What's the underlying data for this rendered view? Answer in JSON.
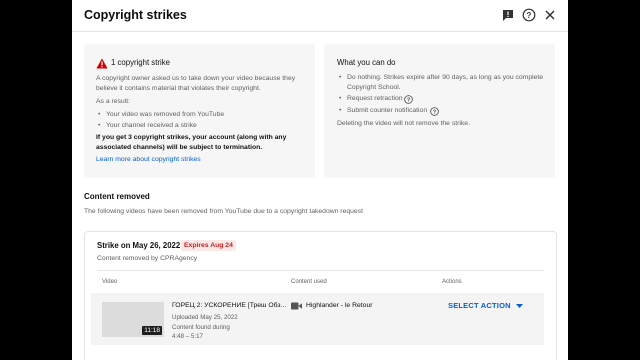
{
  "dialog": {
    "title": "Copyright strikes",
    "icons": [
      "feedback-icon",
      "help-icon",
      "close-icon"
    ]
  },
  "summary": {
    "heading": "1 copyright strike",
    "desc_line1": "A copyright owner asked us to take down your video because they",
    "desc_line2": "believe it contains material that violates their copyright.",
    "result_label": "As a result:",
    "results": [
      "Your video was removed from YouTube",
      "Your channel received a strike"
    ],
    "warning_line1": "If you get 3 copyright strikes, your account (along with any",
    "warning_line2": "associated channels) will be subject to termination.",
    "learn_more": "Learn more about copyright strikes"
  },
  "options": {
    "heading": "What you can do",
    "item1_line1": "Do nothing. Strikes expire after 90 days, as long as you complete",
    "item1_line2": "Copyright School.",
    "item2": "Request retraction",
    "item3": "Submit counter notification",
    "note": "Deleting the video will not remove the strike."
  },
  "removed": {
    "heading": "Content removed",
    "desc": "The following videos have been removed from YouTube due to a copyright takedown request"
  },
  "strike": {
    "title": "Strike on May 26, 2022",
    "expires": "Expires Aug 24",
    "removed_by": "Content removed by CPRAgency",
    "columns": {
      "video": "Video",
      "content": "Content used",
      "actions": "Actions"
    },
    "video": {
      "title": "ГОРЕЦ 2: УСКОРЕНИЕ [Треш Обз...",
      "uploaded": "Uploaded May 25, 2022",
      "found_label": "Content found during",
      "found_range": "4:48 – 5:17",
      "duration": "11:18"
    },
    "content_used": "Highlander - le Retour",
    "action_label": "SELECT ACTION"
  },
  "colors": {
    "accent": "#065fd4",
    "warning": "#c5221f",
    "badge_bg": "#fde8e8"
  }
}
